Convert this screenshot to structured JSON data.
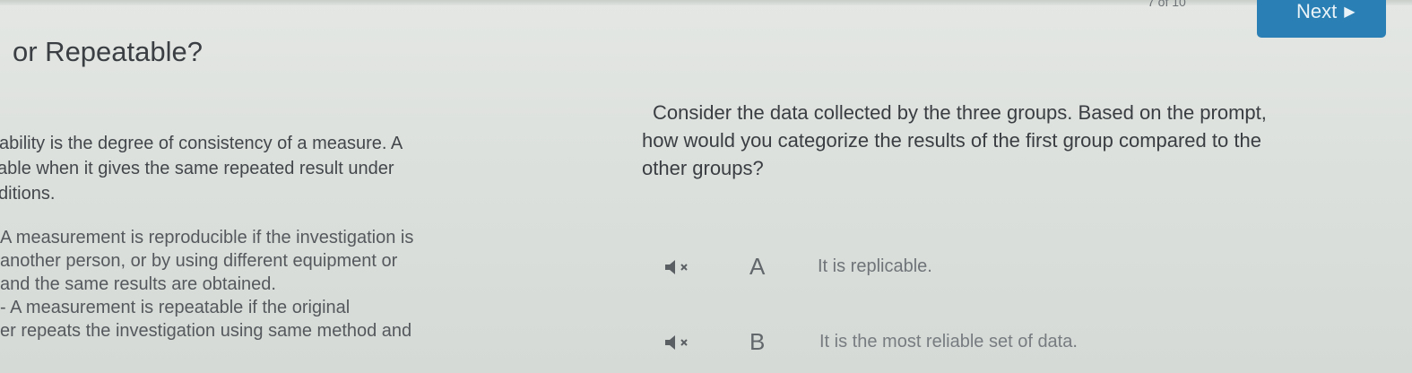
{
  "header": {
    "progress_text": "7 of 10",
    "next_label": "Next"
  },
  "page_title": "or Repeatable?",
  "left_panel": {
    "intro_lines": [
      "ability is the degree of consistency of a measure. A",
      "able when it gives the same repeated result under",
      "ditions."
    ],
    "reproducible_lines": [
      "A measurement is reproducible if the investigation is",
      "another person, or by using different equipment or",
      "and the same results are obtained."
    ],
    "repeatable_lines": [
      "- A measurement is repeatable if the original",
      "er repeats the investigation using same method and"
    ]
  },
  "question": {
    "lines": [
      "Consider the data collected by the three groups. Based on the prompt,",
      "how would you categorize the results of the first group compared to the",
      "other groups?"
    ]
  },
  "choices": [
    {
      "letter": "A",
      "text": "It is replicable.",
      "icon": "speaker-icon"
    },
    {
      "letter": "B",
      "text": "It is the most reliable set of data.",
      "icon": "speaker-icon"
    }
  ]
}
